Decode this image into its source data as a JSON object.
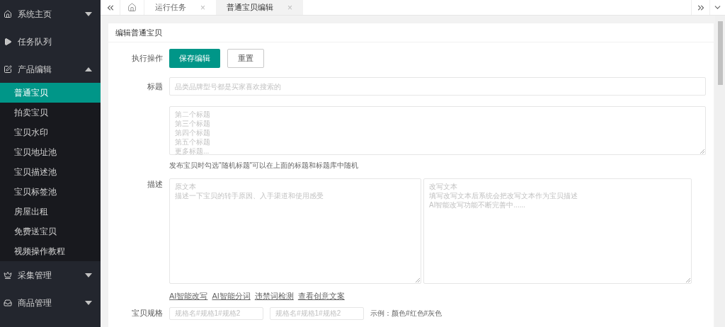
{
  "sidebar": {
    "items": [
      {
        "label": "系统主页",
        "kind": "home",
        "expanded": false
      },
      {
        "label": "任务队列",
        "kind": "play"
      },
      {
        "label": "产品编辑",
        "kind": "edit",
        "expanded": true,
        "children": [
          {
            "label": "普通宝贝",
            "selected": true
          },
          {
            "label": "拍卖宝贝",
            "selected": false
          },
          {
            "label": "宝贝水印",
            "selected": false
          },
          {
            "label": "宝贝地址池",
            "selected": false
          },
          {
            "label": "宝贝描述池",
            "selected": false
          },
          {
            "label": "宝贝标签池",
            "selected": false
          },
          {
            "label": "房屋出租",
            "selected": false
          },
          {
            "label": "免费送宝贝",
            "selected": false
          },
          {
            "label": "视频操作教程",
            "selected": false
          }
        ]
      },
      {
        "label": "采集管理",
        "kind": "crown",
        "expanded": false
      },
      {
        "label": "商品管理",
        "kind": "inbox",
        "expanded": false
      }
    ]
  },
  "tabs": [
    {
      "kind": "home",
      "selected": false
    },
    {
      "kind": "page",
      "label": "运行任务",
      "close": "×",
      "selected": false
    },
    {
      "kind": "page",
      "label": "普通宝贝编辑",
      "close": "×",
      "selected": true
    }
  ],
  "card": {
    "title": "编辑普通宝贝",
    "action_label": "执行操作",
    "buttons": [
      {
        "label": "保存编辑",
        "kind": "primary"
      },
      {
        "label": "重置",
        "kind": "default"
      }
    ],
    "title_label": "标题",
    "title_placeholder": "品类品牌型号都是买家喜欢搜索的",
    "more_titles_placeholder": [
      "第二个标题",
      "第三个标题",
      "第四个标题",
      "第五个标题",
      "更多标题..."
    ],
    "title_hint": "发布宝贝时勾选\"随机标题\"可以在上面的标题和标题库中随机",
    "description_label": "描述",
    "original_placeholder": [
      "原文本",
      "描述一下宝贝的转手原因、入手渠道和使用感受"
    ],
    "rewrite_placeholder": [
      "改写文本",
      "填写改写文本后系统会把改写文本作为宝贝描述",
      "AI智能改写功能不断完善中......"
    ],
    "links": [
      "AI智能改写",
      "AI智能分词",
      "违禁词检测",
      "查看创意文案"
    ],
    "spec_label": "宝贝规格",
    "spec_placeholders": [
      "规格名#规格1#规格2",
      "规格名#规格1#规格2"
    ],
    "spec_example": "示例：颜色#红色#灰色"
  }
}
